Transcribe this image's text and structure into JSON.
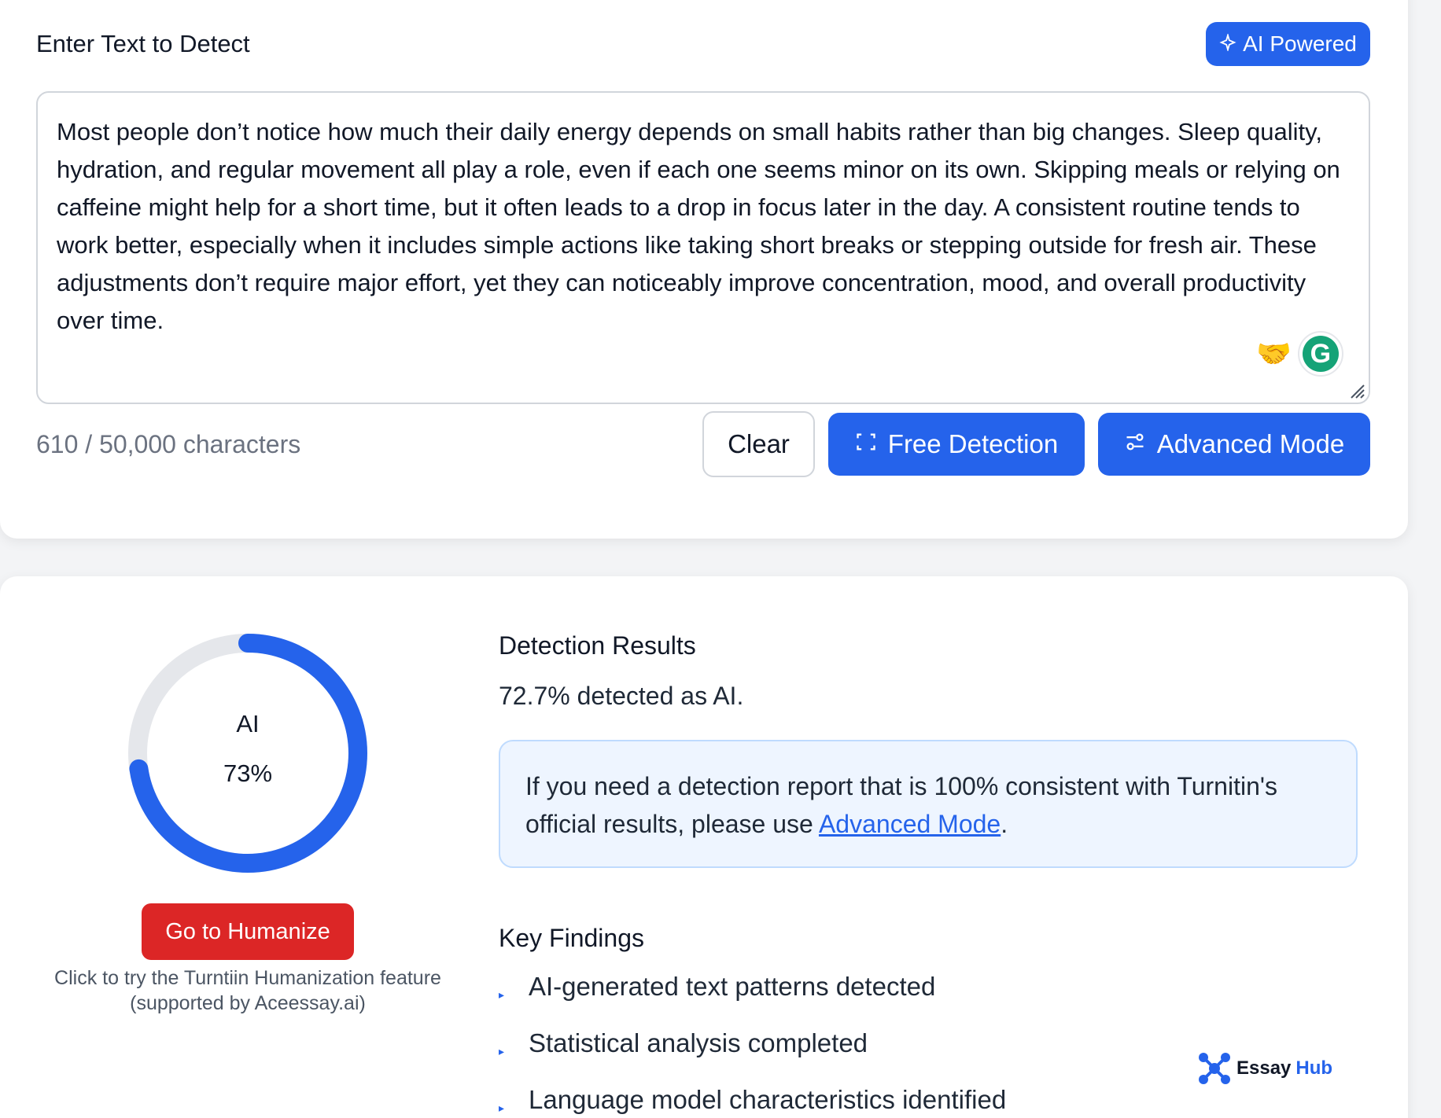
{
  "input": {
    "title": "Enter Text to Detect",
    "badge_label": "AI Powered",
    "text": "Most people don’t notice how much their daily energy depends on small habits rather than big changes. Sleep quality, hydration, and regular movement all play a role, even if each one seems minor on its own. Skipping meals or relying on caffeine might help for a short time, but it often leads to a drop in focus later in the day. A consistent routine tends to work better, especially when it includes simple actions like taking short breaks or stepping outside for fresh air. These adjustments don’t require major effort, yet they can noticeably improve concentration, mood, and overall productivity over time.",
    "char_count": "610 / 50,000 characters",
    "buttons": {
      "clear": "Clear",
      "free_detection": "Free Detection",
      "advanced_mode": "Advanced Mode"
    },
    "grammarly_letter": "G"
  },
  "results": {
    "gauge": {
      "label": "AI",
      "value_text": "73%",
      "fraction": 0.727,
      "color": "#2563eb",
      "track_color": "#e5e7eb"
    },
    "humanize_button": "Go to Humanize",
    "humanize_caption_line1": "Click to try the Turntiin Humanization feature",
    "humanize_caption_line2": "(supported by Aceessay.ai)",
    "title": "Detection Results",
    "summary": "72.7% detected as AI.",
    "info_text_before": "If you need a detection report that is 100% consistent with Turnitin's official results, please use ",
    "info_link": "Advanced Mode",
    "info_text_after": ".",
    "findings_title": "Key Findings",
    "findings": [
      "AI-generated text patterns detected",
      "Statistical analysis completed",
      "Language model characteristics identified"
    ]
  },
  "logo": {
    "part1": "Essay",
    "part2": "Hub"
  }
}
